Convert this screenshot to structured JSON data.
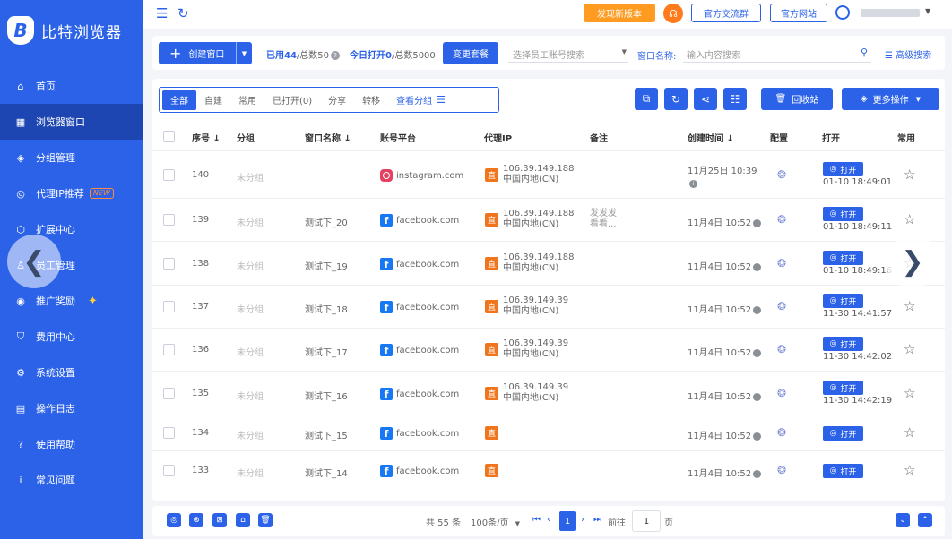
{
  "app": {
    "name": "比特浏览器",
    "logo_letter": "B"
  },
  "sidebar": {
    "items": [
      {
        "label": "首页",
        "icon": "home-icon",
        "glyph": "⌂"
      },
      {
        "label": "浏览器窗口",
        "icon": "grid-icon",
        "glyph": "▦",
        "active": true
      },
      {
        "label": "分组管理",
        "icon": "layers-icon",
        "glyph": "◈"
      },
      {
        "label": "代理IP推荐",
        "icon": "location-icon",
        "glyph": "◎",
        "badge": "NEW"
      },
      {
        "label": "扩展中心",
        "icon": "cube-icon",
        "glyph": "⬡"
      },
      {
        "label": "员工管理",
        "icon": "users-icon",
        "glyph": "♙"
      },
      {
        "label": "推广奖励",
        "icon": "reward-icon",
        "glyph": "◉",
        "sparkle": "✦"
      },
      {
        "label": "费用中心",
        "icon": "shield-icon",
        "glyph": "⛉"
      },
      {
        "label": "系统设置",
        "icon": "settings-icon",
        "glyph": "⚙"
      },
      {
        "label": "操作日志",
        "icon": "log-icon",
        "glyph": "▤"
      },
      {
        "label": "使用帮助",
        "icon": "help-icon",
        "glyph": "?"
      },
      {
        "label": "常见问题",
        "icon": "info-icon",
        "glyph": "i"
      }
    ]
  },
  "topbar": {
    "new_version": "发现新版本",
    "official_group": "官方交流群",
    "official_site": "官方网站"
  },
  "toolbar": {
    "create": "创建窗口",
    "used_label": "已用44",
    "total_label": "/总数50",
    "today_label": "今日打开0",
    "today_total": "/总数5000",
    "change_plan": "变更套餐",
    "employee_placeholder": "选择员工账号搜索",
    "name_label": "窗口名称:",
    "name_placeholder": "输入内容搜索",
    "advanced": "高级搜索"
  },
  "tabs": [
    "全部",
    "自建",
    "常用",
    "已打开(0)",
    "分享",
    "转移",
    "查看分组"
  ],
  "actions": {
    "recycle": "回收站",
    "more": "更多操作"
  },
  "table": {
    "headers": {
      "seq": "序号 ↓",
      "group": "分组",
      "name": "窗口名称 ↓",
      "platform": "账号平台",
      "proxy": "代理IP",
      "note": "备注",
      "created": "创建时间 ↓",
      "config": "配置",
      "open": "打开",
      "fav": "常用"
    },
    "rows": [
      {
        "seq": "140",
        "group": "未分组",
        "name": "",
        "platform": "instagram.com",
        "pi": "ig",
        "ip": "106.39.149.188",
        "region": "中国内地(CN)",
        "note1": "",
        "note2": "",
        "created": "11月25日 10:39",
        "open_time": "01-10 18:49:01"
      },
      {
        "seq": "139",
        "group": "未分组",
        "name": "测试下_20",
        "platform": "facebook.com",
        "pi": "fb",
        "ip": "106.39.149.188",
        "region": "中国内地(CN)",
        "note1": "发发发",
        "note2": "看看...",
        "created": "11月4日 10:52",
        "open_time": "01-10 18:49:11"
      },
      {
        "seq": "138",
        "group": "未分组",
        "name": "测试下_19",
        "platform": "facebook.com",
        "pi": "fb",
        "ip": "106.39.149.188",
        "region": "中国内地(CN)",
        "note1": "",
        "note2": "",
        "created": "11月4日 10:52",
        "open_time": "01-10 18:49:16"
      },
      {
        "seq": "137",
        "group": "未分组",
        "name": "测试下_18",
        "platform": "facebook.com",
        "pi": "fb",
        "ip": "106.39.149.39",
        "region": "中国内地(CN)",
        "note1": "",
        "note2": "",
        "created": "11月4日 10:52",
        "open_time": "11-30 14:41:57"
      },
      {
        "seq": "136",
        "group": "未分组",
        "name": "测试下_17",
        "platform": "facebook.com",
        "pi": "fb",
        "ip": "106.39.149.39",
        "region": "中国内地(CN)",
        "note1": "",
        "note2": "",
        "created": "11月4日 10:52",
        "open_time": "11-30 14:42:02"
      },
      {
        "seq": "135",
        "group": "未分组",
        "name": "测试下_16",
        "platform": "facebook.com",
        "pi": "fb",
        "ip": "106.39.149.39",
        "region": "中国内地(CN)",
        "note1": "",
        "note2": "",
        "created": "11月4日 10:52",
        "open_time": "11-30 14:42:19"
      },
      {
        "seq": "134",
        "group": "未分组",
        "name": "测试下_15",
        "platform": "facebook.com",
        "pi": "fb",
        "ip": "",
        "region": "",
        "note1": "",
        "note2": "",
        "created": "11月4日 10:52",
        "open_time": ""
      },
      {
        "seq": "133",
        "group": "未分组",
        "name": "测试下_14",
        "platform": "facebook.com",
        "pi": "fb",
        "ip": "",
        "region": "",
        "note1": "",
        "note2": "",
        "created": "11月4日 10:52",
        "open_time": ""
      }
    ],
    "open_label": "打开",
    "proxy_badge": "直"
  },
  "footer": {
    "total": "共 55 条",
    "per_page": "100条/页",
    "current_page": "1",
    "goto": "前往",
    "goto_value": "1",
    "page_unit": "页"
  },
  "colors": {
    "brand": "#2b62e8",
    "orange": "#ff9b21",
    "sidebar_active": "#1d46b3"
  }
}
